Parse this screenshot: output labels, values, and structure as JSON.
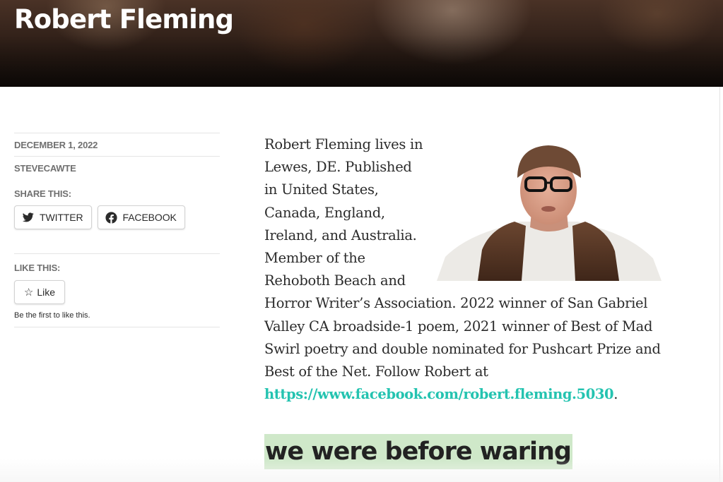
{
  "header": {
    "title": "Robert Fleming"
  },
  "meta": {
    "date": "DECEMBER 1, 2022",
    "author": "STEVECAWTE",
    "share_heading": "SHARE THIS:",
    "share_buttons": [
      {
        "label": "TWITTER",
        "icon": "twitter-icon"
      },
      {
        "label": "FACEBOOK",
        "icon": "facebook-icon"
      }
    ],
    "like_heading": "LIKE THIS:",
    "like_button": {
      "label": "Like",
      "icon": "star-icon"
    },
    "like_note": "Be the first to like this."
  },
  "post": {
    "bio_text": "Robert Fleming lives in Lewes, DE. Published in United States, Canada, England, Ireland, and Australia. Member of the Rehoboth Beach and Horror Writer’s Association. 2022 winner of San Gabriel Valley CA broadside-1 poem, 2021 winner of Best of Mad Swirl poetry and double nominated for Pushcart Prize and Best of the Net. Follow Robert at",
    "link_text": "https://www.facebook.com/robert.fleming.5030",
    "after_link": ".",
    "next_title": "we were before waring"
  },
  "colors": {
    "link": "#24c3b0",
    "title_highlight": "#cfe8c9",
    "meta_text": "#707070"
  }
}
